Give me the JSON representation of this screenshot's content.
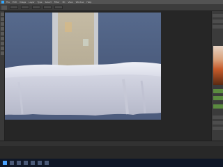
{
  "app": {
    "name": "Photoshop",
    "accent_color": "#31a8ff"
  },
  "menubar": {
    "items": [
      "File",
      "Edit",
      "Image",
      "Layer",
      "Type",
      "Select",
      "Filter",
      "3D",
      "View",
      "Window",
      "Help"
    ]
  },
  "statusbar": {
    "text": ""
  },
  "canvas": {
    "scene": "painting",
    "colors": {
      "wall": "#576a8d",
      "door": "#c5bba4",
      "doorframe": "#c9cbcf",
      "tablecloth": "#dfe1ec",
      "shadow": "#b7b9c9"
    }
  },
  "panel": {
    "color_swatch": "#5b8b3f"
  },
  "taskbar": {
    "icons": [
      "start-icon",
      "search-icon",
      "task-view-icon",
      "explorer-icon",
      "browser-icon",
      "photoshop-icon",
      "mail-icon"
    ]
  }
}
